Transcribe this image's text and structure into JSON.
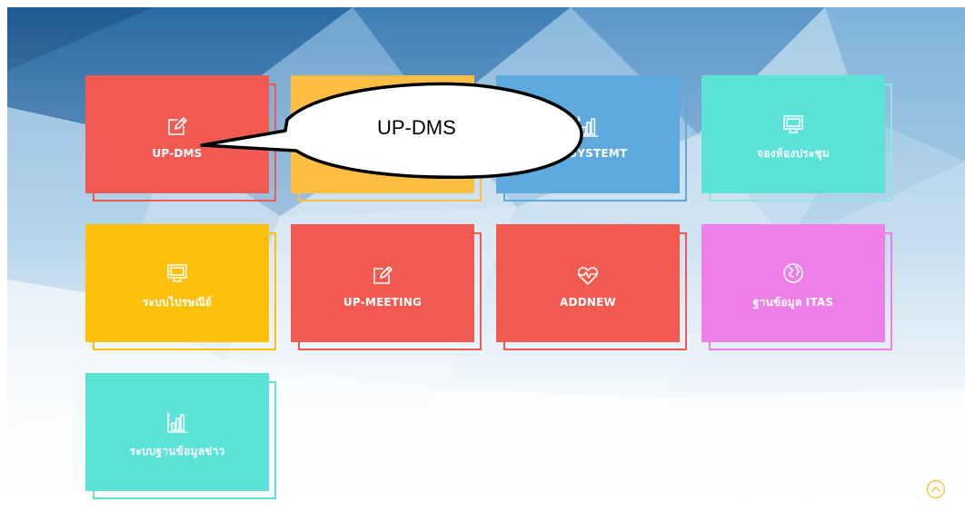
{
  "tiles": [
    {
      "label": "UP-DMS",
      "icon": "edit-icon",
      "color": "#f25a51",
      "outline": "#f25a51"
    },
    {
      "label": "",
      "icon": "none",
      "color": "#fdbe42",
      "outline": "#fdbe42"
    },
    {
      "label": "PR SYSTEMT",
      "icon": "bar-chart-icon",
      "color": "#5eaade",
      "outline": "#5eaade"
    },
    {
      "label": "จองห้องประชุม",
      "icon": "monitor-icon",
      "color": "#5ce3d7",
      "outline": "#8fe8e0"
    },
    {
      "label": "ระบบไปรษณีย์",
      "icon": "monitor-icon",
      "color": "#fdc10c",
      "outline": "#fdc10c"
    },
    {
      "label": "UP-MEETING",
      "icon": "edit-icon",
      "color": "#f25a51",
      "outline": "#f25a51"
    },
    {
      "label": "ADDNEW",
      "icon": "heart-pulse-icon",
      "color": "#f25a51",
      "outline": "#f25a51"
    },
    {
      "label": "ฐานข้อมูล ITAS",
      "icon": "globe-icon",
      "color": "#ee7ee8",
      "outline": "#ee7ee8"
    },
    {
      "label": "ระบบฐานข้อมูลข่าว",
      "icon": "bar-chart-icon",
      "color": "#5ce3d7",
      "outline": "#5ce3d7"
    }
  ],
  "callout": {
    "text": "UP-DMS"
  },
  "scroll_top": {
    "icon": "chevron-up-circle-icon",
    "color": "#f3c542"
  }
}
